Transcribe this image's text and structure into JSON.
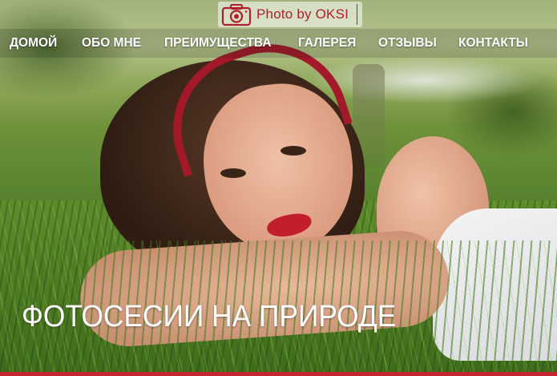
{
  "brand": {
    "logo_text": "Photo by OKSI",
    "logo_icon": "camera-icon",
    "accent_color": "#c4262f"
  },
  "nav": {
    "items": [
      {
        "label": "ДОМОЙ"
      },
      {
        "label": "ОБО МНЕ"
      },
      {
        "label": "ПРЕИМУЩЕСТВА"
      },
      {
        "label": "ГАЛЕРЕЯ"
      },
      {
        "label": "ОТЗЫВЫ"
      },
      {
        "label": "КОНТАКТЫ"
      }
    ]
  },
  "hero": {
    "headline": "ФОТОСЕСИИ НА ПРИРОДЕ",
    "image": "portrait-photo"
  }
}
